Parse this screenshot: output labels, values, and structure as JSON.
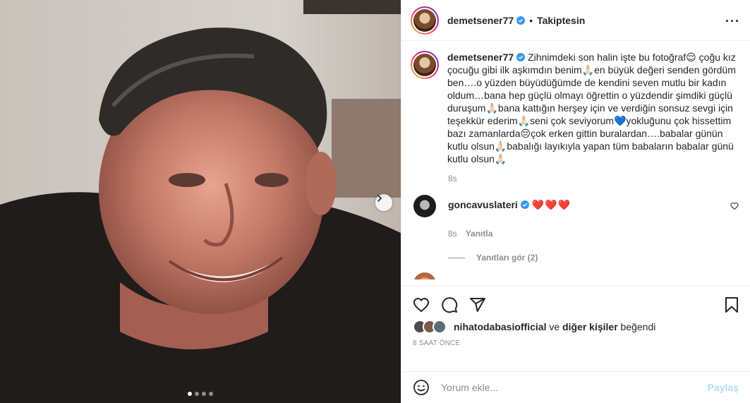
{
  "post": {
    "username": "demetsener77",
    "follow_status": "Takiptesin",
    "separator": "•",
    "more_icon": "more-horizontal-icon",
    "carousel": {
      "active_index": 0,
      "total": 4
    }
  },
  "caption": {
    "username": "demetsener77",
    "text": "Zihnimdeki son halin işte bu fotoğraf😌 çoğu kız çocuğu gibi ilk aşkımdın benim🙏🏻en büyük değeri senden gördüm ben….o yüzden büyüdüğümde de kendini seven mutlu bir kadın oldum…bana hep güçlü olmayı öğrettin o yüzdendir şimdiki güçlü duruşum🙏🏻bana kattığın herşey için ve verdiğin sonsuz sevgi için teşekkür ederim🙏🏻seni çok seviyorum💙yokluğunu çok hissettim bazı zamanlarda😔çok erken gittin buralardan….babalar günün kutlu olsun🙏🏻babalığı layıkıyla yapan tüm babaların babalar günü kutlu olsun🙏🏻",
    "time": "8s"
  },
  "comments": [
    {
      "username": "goncavuslateri",
      "text": "❤️❤️❤️",
      "time": "8s",
      "reply_label": "Yanıtla",
      "view_replies": "Yanıtları gör (2)"
    }
  ],
  "actions": {
    "like_icon": "heart-icon",
    "comment_icon": "comment-icon",
    "share_icon": "send-icon",
    "save_icon": "bookmark-icon"
  },
  "likes": {
    "user": "nihatodabasiofficial",
    "connector": "ve",
    "others": "diğer kişiler",
    "suffix": "beğendi"
  },
  "timestamp": "8 SAAT ÖNCE",
  "comment_box": {
    "placeholder": "Yorum ekle...",
    "post_label": "Paylaş",
    "emoji_icon": "emoji-icon"
  },
  "colors": {
    "verified": "#3897f0",
    "post_button_disabled": "#b2dffc",
    "heart": "#ed1c24"
  }
}
